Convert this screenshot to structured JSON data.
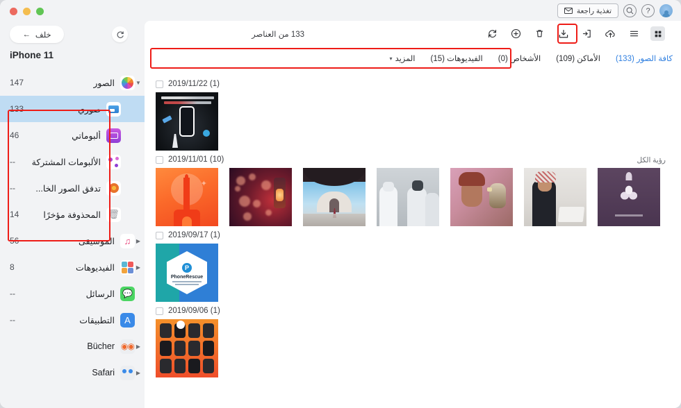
{
  "titlebar": {
    "feedback_label": "تغذية راجعة",
    "mail_icon": "mail-icon",
    "search_icon": "search-icon",
    "help_icon": "help-icon",
    "avatar_icon": "user-avatar"
  },
  "sidebar": {
    "back_label": "خلف",
    "back_arrow": "←",
    "refresh_icon": "refresh-icon",
    "device_name": "iPhone 11",
    "items": [
      {
        "label": "الصور",
        "count": "147",
        "arrow": "▼",
        "icon": "photos-icon",
        "level": 0,
        "selected": false
      },
      {
        "label": "صوري",
        "count": "133",
        "arrow": "",
        "icon": "my-photos-icon",
        "level": 1,
        "selected": true
      },
      {
        "label": "ألبوماتي",
        "count": "46",
        "arrow": "",
        "icon": "my-albums-icon",
        "level": 1,
        "selected": false
      },
      {
        "label": "الألبومات المشتركة",
        "count": "--",
        "arrow": "",
        "icon": "shared-albums-icon",
        "level": 1,
        "selected": false
      },
      {
        "label": "تدفق الصور الخا...",
        "count": "--",
        "arrow": "",
        "icon": "photo-stream-icon",
        "level": 1,
        "selected": false
      },
      {
        "label": "المحذوفة مؤخرًا",
        "count": "14",
        "arrow": "",
        "icon": "trash-icon",
        "level": 1,
        "selected": false
      },
      {
        "label": "الموسيقى",
        "count": "56",
        "arrow": "▶",
        "icon": "music-icon",
        "level": 0,
        "selected": false
      },
      {
        "label": "الفيديوهات",
        "count": "8",
        "arrow": "▶",
        "icon": "videos-icon",
        "level": 0,
        "selected": false
      },
      {
        "label": "الرسائل",
        "count": "--",
        "arrow": "",
        "icon": "messages-icon",
        "level": 0,
        "selected": false
      },
      {
        "label": "التطبيقات",
        "count": "--",
        "arrow": "",
        "icon": "apps-icon",
        "level": 0,
        "selected": false
      },
      {
        "label": "Bücher",
        "count": "",
        "arrow": "▶",
        "icon": "books-icon",
        "level": 0,
        "selected": false
      },
      {
        "label": "Safari",
        "count": "",
        "arrow": "▶",
        "icon": "safari-icon",
        "level": 0,
        "selected": false
      }
    ]
  },
  "content": {
    "item_count_text": "133 من العناصر",
    "toolbar": [
      {
        "name": "refresh-icon",
        "glyph": "refresh",
        "highlighted": false,
        "boxed": false
      },
      {
        "name": "add-icon",
        "glyph": "plus",
        "highlighted": false,
        "boxed": false
      },
      {
        "name": "delete-icon",
        "glyph": "trash",
        "highlighted": false,
        "boxed": false
      },
      {
        "name": "export-to-mac-icon",
        "glyph": "export",
        "highlighted": true,
        "boxed": false
      },
      {
        "name": "import-icon",
        "glyph": "import",
        "highlighted": false,
        "boxed": false
      },
      {
        "name": "cloud-upload-icon",
        "glyph": "cloud",
        "highlighted": false,
        "boxed": false
      },
      {
        "name": "list-view-icon",
        "glyph": "list",
        "highlighted": false,
        "boxed": false
      },
      {
        "name": "grid-view-icon",
        "glyph": "grid",
        "highlighted": false,
        "boxed": true
      }
    ],
    "tabs": [
      {
        "label": "كافة الصور (133)",
        "active": true
      },
      {
        "label": "الأماكن (109)",
        "active": false
      },
      {
        "label": "الأشخاص (0)",
        "active": false
      },
      {
        "label": "الفيديوهات (15)",
        "active": false
      },
      {
        "label": "المزيد",
        "active": false,
        "has_chevron": true
      }
    ],
    "see_all_label": "رؤية الكل",
    "groups": [
      {
        "date_label": "2019/11/22 (1)",
        "show_see_all": false,
        "thumbs": [
          "t-phonepad"
        ]
      },
      {
        "date_label": "2019/11/01 (10)",
        "show_see_all": true,
        "thumbs": [
          "t-lantern-orange",
          "t-bokeh",
          "t-arch",
          "t-group1",
          "t-falcon",
          "t-laptop",
          "t-calli"
        ]
      },
      {
        "date_label": "2019/09/17 (1)",
        "show_see_all": false,
        "thumbs": [
          "t-rescue"
        ]
      },
      {
        "date_label": "2019/09/06 (1)",
        "show_see_all": false,
        "thumbs": [
          "t-springboard"
        ]
      }
    ]
  },
  "colors": {
    "accent_blue": "#2f7fe0",
    "highlight_red": "#ee1c17",
    "selection_blue": "#bfdcf3",
    "sidebar_bg": "#f2f3f5",
    "content_bg": "#ffffff"
  }
}
